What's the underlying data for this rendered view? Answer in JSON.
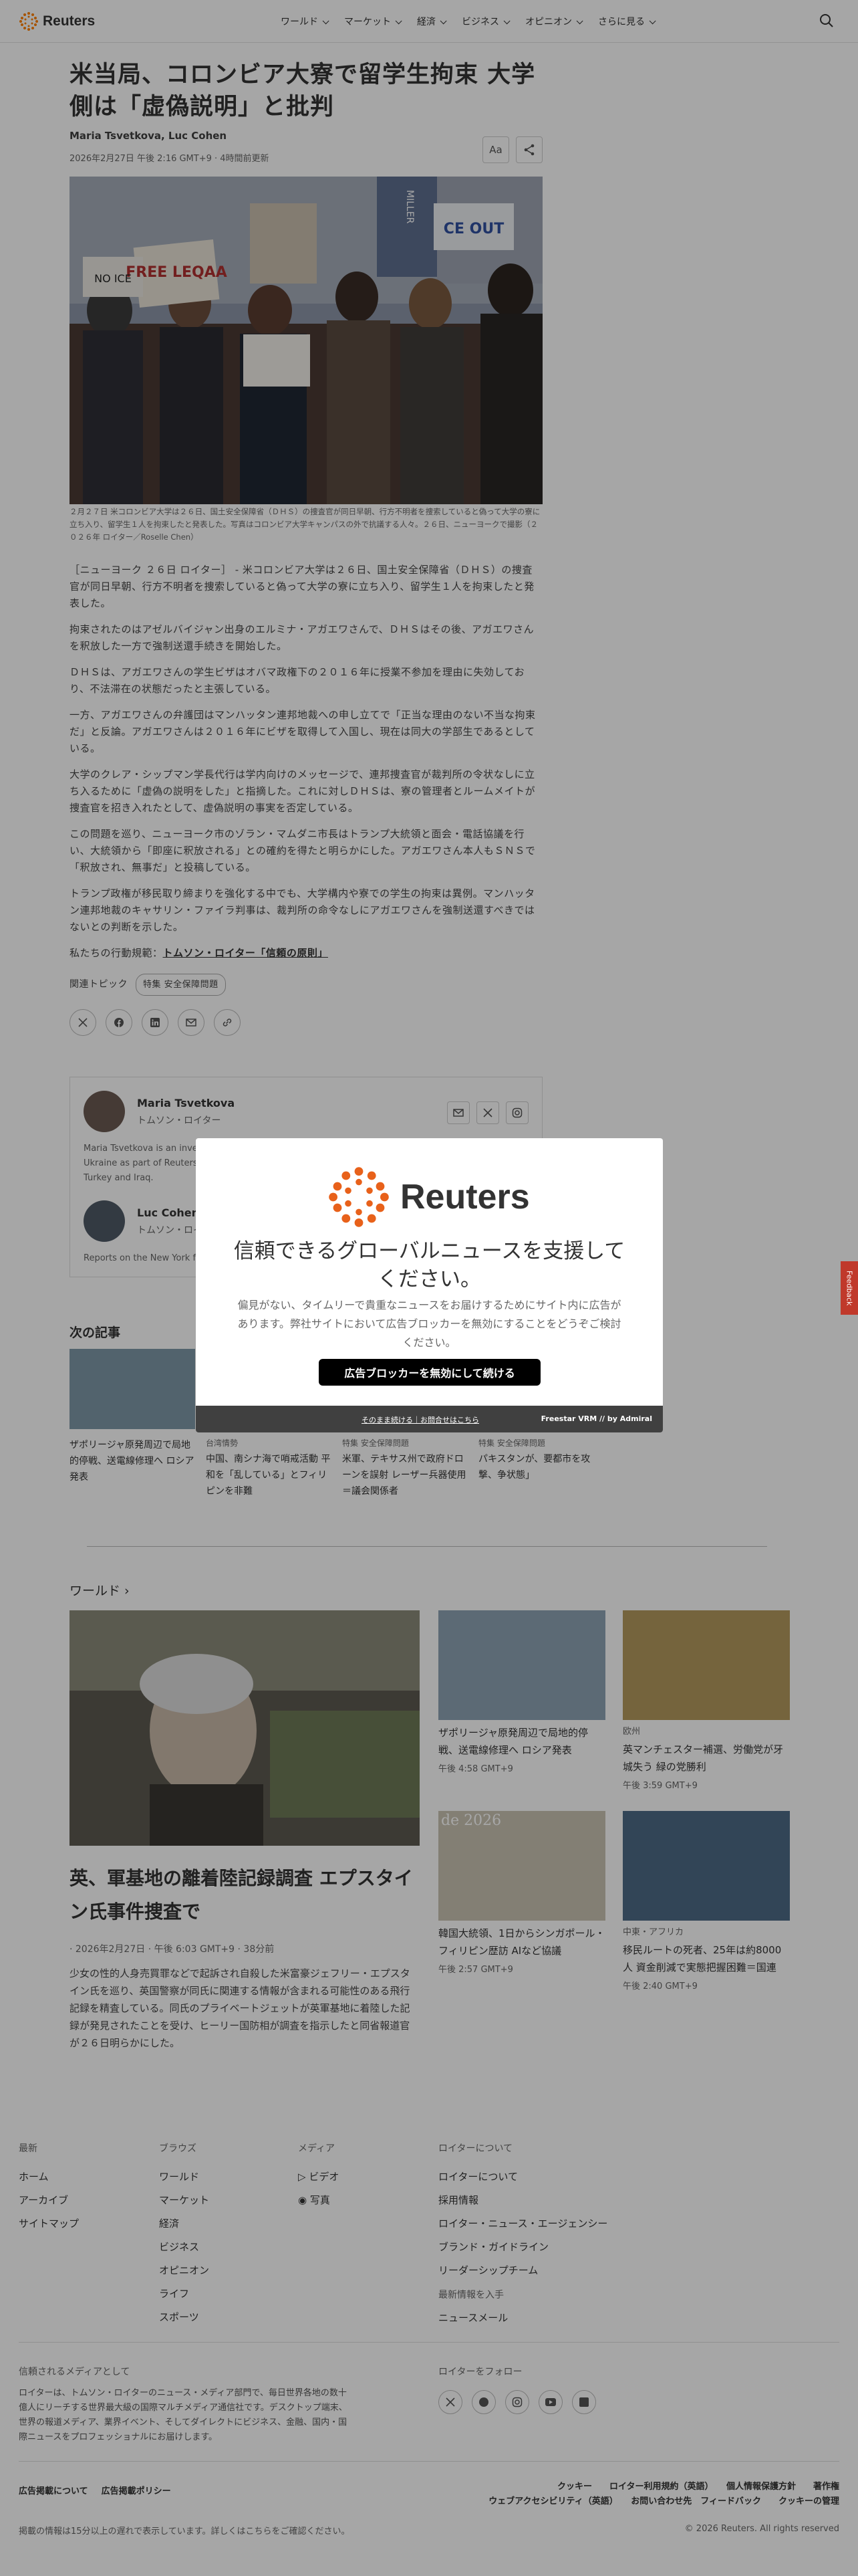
{
  "header": {
    "logo_text": "Reuters",
    "nav": [
      "ワールド",
      "マーケット",
      "経済",
      "ビジネス",
      "オピニオン",
      "さらに見る"
    ]
  },
  "article": {
    "headline": "米当局、コロンビア大寮で留学生拘束 大学側は「虚偽説明」と批判",
    "authors": "Maria Tsvetkova, Luc Cohen",
    "date": "2026年2月27日 午後 2:16 GMT+9 · 4時間前更新",
    "font_button": "Aa",
    "photo_signs": [
      "FREE LEQAA",
      "NO ICE",
      "CE OUT",
      "MILLER"
    ],
    "caption": "２月２７日 米コロンビア大学は２６日、国土安全保障省（ＤＨＳ）の捜査官が同日早朝、行方不明者を捜索していると偽って大学の寮に立ち入り、留学生１人を拘束したと発表した。写真はコロンビア大学キャンパスの外で抗議する人々。２６日、ニューヨークで撮影（２０２６年 ロイター／Roselle Chen）",
    "paragraphs": [
      "［ニューヨーク ２６日 ロイター］ - 米コロンビア大学は２６日、国土安全保障省（ＤＨＳ）の捜査官が同日早朝、行方不明者を捜索していると偽って大学の寮に立ち入り、留学生１人を拘束したと発表した。",
      "拘束されたのはアゼルバイジャン出身のエルミナ・アガエワさんで、ＤＨＳはその後、アガエワさんを釈放した一方で強制送還手続きを開始した。",
      "ＤＨＳは、アガエワさんの学生ビザはオバマ政権下の２０１６年に授業不参加を理由に失効しており、不法滞在の状態だったと主張している。",
      "一方、アガエワさんの弁護団はマンハッタン連邦地裁への申し立てで「正当な理由のない不当な拘束だ」と反論。アガエワさんは２０１６年にビザを取得して入国し、現在は同大の学部生であるとしている。",
      "大学のクレア・シップマン学長代行は学内向けのメッセージで、連邦捜査官が裁判所の令状なしに立ち入るために「虚偽の説明をした」と指摘した。これに対しＤＨＳは、寮の管理者とルームメイトが捜査官を招き入れたとして、虚偽説明の事実を否定している。",
      "この問題を巡り、ニューヨーク市のゾラン・マムダニ市長はトランプ大統領と面会・電話協議を行い、大統領から「即座に釈放される」との確約を得たと明らかにした。アガエワさん本人もＳＮＳで「釈放され、無事だ」と投稿している。",
      "トランプ政権が移民取り締まりを強化する中でも、大学構内や寮での学生の拘束は異例。マンハッタン連邦地裁のキャサリン・ファイラ判事は、裁判所の命令なしにアガエワさんを強制送還すべきではないとの判断を示した。"
    ],
    "principle_prefix": "私たちの行動規範：",
    "principle_link": "トムソン・ロイター「信頼の原則」",
    "topics_label": "関連トピック",
    "topic_pill": "特集 安全保障問題"
  },
  "authors": [
    {
      "name": "Maria Tsvetkova",
      "role": "トムソン・ロイター",
      "bio": "Maria Tsvetkova is an investigative reporter who has covered the Russian full-scale invasion of Ukraine as part of Reuters' war coverage. She has reported from the conflict zones in Ukraine, Turkey and Iraq."
    },
    {
      "name": "Luc Cohen",
      "role": "トムソン・ロイター",
      "bio": "Reports on the New York federal courts. Previously reported on Venezuela and Argentina."
    }
  ],
  "next": {
    "title": "次の記事",
    "cards": [
      {
        "cat": "",
        "title": "ザポリージャ原発周辺で局地的停戦、送電線修理へ ロシア発表"
      },
      {
        "cat": "台湾情勢",
        "title": "中国、南シナ海で哨戒活動 平和を「乱している」とフィリピンを非難"
      },
      {
        "cat": "特集 安全保障問題",
        "title": "米軍、テキサス州で政府ドローンを誤射 レーザー兵器使用＝議会関係者"
      },
      {
        "cat": "特集 安全保障問題",
        "title": "パキスタンが、要都市を攻撃、争状態」"
      }
    ]
  },
  "modal": {
    "logo_text": "Reuters",
    "heading": "信頼できるグローバルニュースを支援してください。",
    "text": "偏見がない、タイムリーで貴重なニュースをお届けするためにサイト内に広告があります。弊社サイトにおいて広告ブロッカーを無効にすることをどうぞご検討ください。",
    "button": "広告ブロッカーを無効にして続ける",
    "footer_link": "そのまま続ける｜お問合せはこちら",
    "footer_brand": "Freestar VRM // by Admiral"
  },
  "feedback": "Feedback",
  "world": {
    "title": "ワールド",
    "lead": {
      "headline": "英、軍基地の離着陸記録調査 エプスタイン氏事件捜査で",
      "date": "· 2026年2月27日 · 午後 6:03 GMT+9 · 38分前",
      "text": "少女の性的人身売買罪などで起訴され自殺した米富豪ジェフリー・エプスタイン氏を巡り、英国警察が同氏に関連する情報が含まれる可能性のある飛行記録を精査している。同氏のプライベートジェットが英軍基地に着陸した記録が発見されたことを受け、ヒーリー国防相が調査を指示したと同省報道官が２６日明らかにした。"
    },
    "cards": [
      {
        "cat": "",
        "title": "ザポリージャ原発周辺で局地的停戦、送電線修理へ ロシア発表",
        "time": "午後 4:58 GMT+9"
      },
      {
        "cat": "欧州",
        "title": "英マンチェスター補選、労働党が牙城失う 緑の党勝利",
        "time": "午後 3:59 GMT+9"
      },
      {
        "cat": "",
        "title": "韓国大統領、1日からシンガポール・フィリピン歴訪 AIなど協議",
        "time": "午後 2:57 GMT+9",
        "overlay": "de 2026"
      },
      {
        "cat": "中東・アフリカ",
        "title": "移民ルートの死者、25年は約8000人 資金削減で実態把握困難＝国連",
        "time": "午後 2:40 GMT+9"
      }
    ]
  },
  "footer": {
    "col1": {
      "head": "最新",
      "links": [
        "ホーム",
        "アーカイブ",
        "サイトマップ"
      ]
    },
    "col2": {
      "head": "ブラウズ",
      "links": [
        "ワールド",
        "マーケット",
        "経済",
        "ビジネス",
        "オピニオン",
        "ライフ",
        "スポーツ"
      ]
    },
    "col3": {
      "head": "メディア",
      "links": [
        "ビデオ",
        "写真"
      ]
    },
    "col4": {
      "head": "ロイターについて",
      "links": [
        "ロイターについて",
        "採用情報",
        "ロイター・ニュース・エージェンシー",
        "ブランド・ガイドライン",
        "リーダーシップチーム"
      ],
      "head2": "最新情報を入手",
      "links2": [
        "ニュースメール"
      ]
    },
    "trust_head": "信頼されるメディアとして",
    "trust_text": "ロイターは、トムソン・ロイターのニュース・メディア部門で、毎日世界各地の数十億人にリーチする世界最大級の国際マルチメディア通信社です。デスクトップ端末、世界の報道メディア、業界イベント、そしてダイレクトにビジネス、金融、国内・国際ニュースをプロフェッショナルにお届けします。",
    "follow_head": "ロイターをフォロー",
    "ad_links": [
      "広告掲載について",
      "広告掲載ポリシー"
    ],
    "legal_line1": "クッキー　　ロイター利用規約（英語）　　個人情報保護方針　　著作権",
    "legal_line2": "ウェブアクセシビリティ（英語）　　お問い合わせ先　フィードバック　　クッキーの管理",
    "disclaimer": "掲載の情報は15分以上の遅れで表示しています。詳しくはこちらをご確認ください。",
    "copyright": "© 2026 Reuters. All rights reserved"
  },
  "colors": {
    "brand_orange": "#ff8000",
    "feedback_red": "#c0392b"
  }
}
